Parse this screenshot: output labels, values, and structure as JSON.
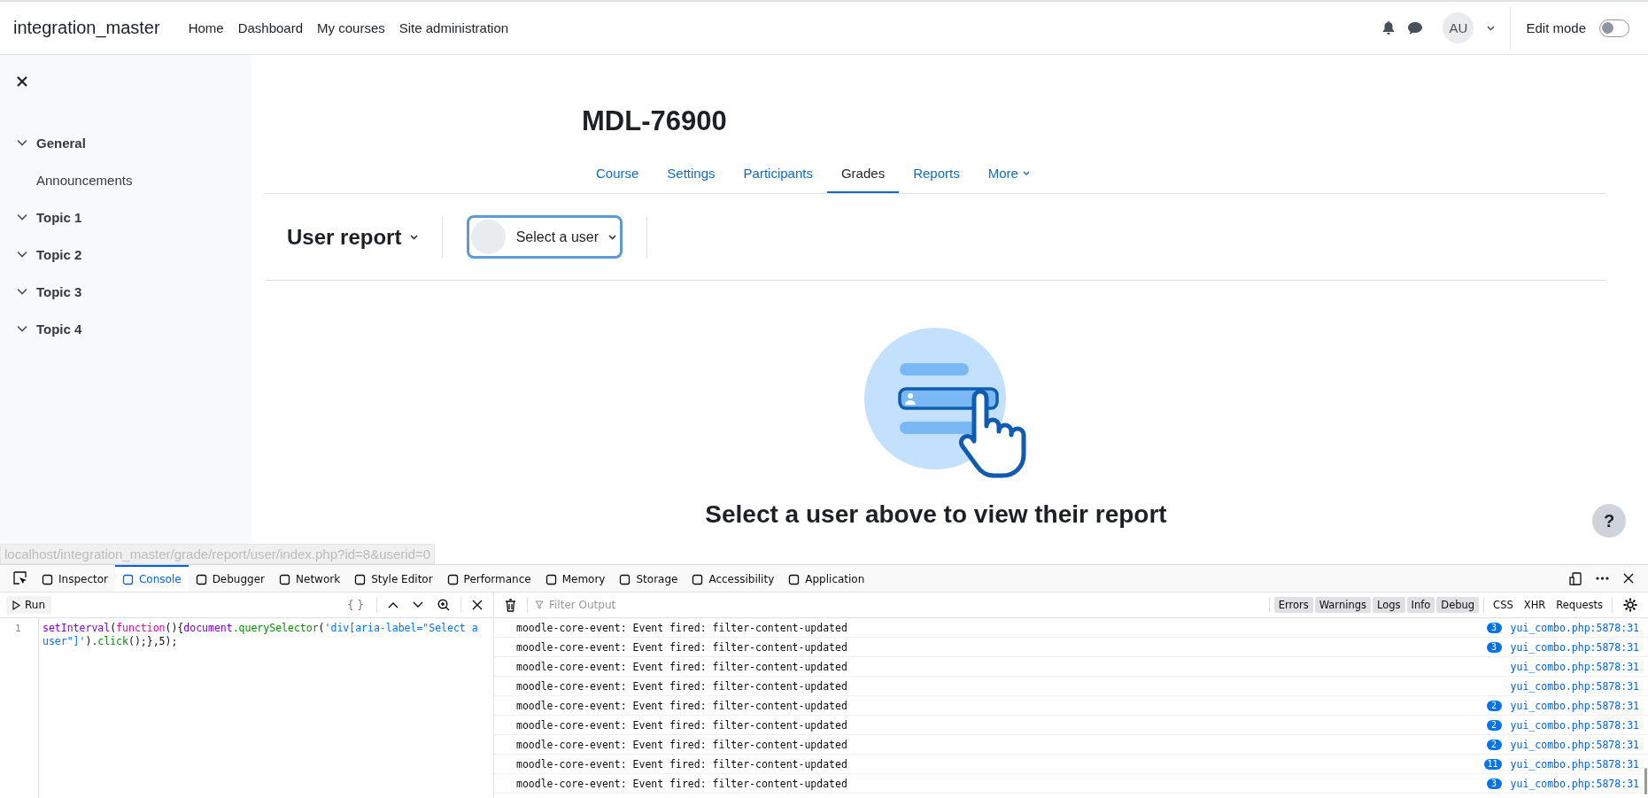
{
  "navbar": {
    "site_name": "integration_master",
    "links": [
      "Home",
      "Dashboard",
      "My courses",
      "Site administration"
    ],
    "avatar": "AU",
    "edit_mode": {
      "label": "Edit mode",
      "on": false
    }
  },
  "sidebar": {
    "items": [
      {
        "label": "General",
        "expanded": true,
        "children": [
          {
            "label": "Announcements"
          }
        ]
      },
      {
        "label": "Topic 1",
        "expanded": true
      },
      {
        "label": "Topic 2",
        "expanded": true
      },
      {
        "label": "Topic 3",
        "expanded": true
      },
      {
        "label": "Topic 4",
        "expanded": true
      }
    ]
  },
  "course": {
    "title": "MDL-76900",
    "tabs": [
      {
        "label": "Course",
        "selected": false
      },
      {
        "label": "Settings",
        "selected": false
      },
      {
        "label": "Participants",
        "selected": false
      },
      {
        "label": "Grades",
        "selected": true
      },
      {
        "label": "Reports",
        "selected": false
      },
      {
        "label": "More",
        "selected": false,
        "dropdown": true
      }
    ],
    "report_selector": "User report",
    "user_selector": "Select a user",
    "empty_message": "Select a user above to view their report",
    "help": "?"
  },
  "status_url": "localhost/integration_master/grade/report/user/index.php?id=8&userid=0",
  "devtools": {
    "tabs": [
      {
        "label": "Inspector",
        "selected": false
      },
      {
        "label": "Console",
        "selected": true
      },
      {
        "label": "Debugger",
        "selected": false
      },
      {
        "label": "Network",
        "selected": false
      },
      {
        "label": "Style Editor",
        "selected": false
      },
      {
        "label": "Performance",
        "selected": false
      },
      {
        "label": "Memory",
        "selected": false
      },
      {
        "label": "Storage",
        "selected": false
      },
      {
        "label": "Accessibility",
        "selected": false
      },
      {
        "label": "Application",
        "selected": false
      }
    ],
    "run": "Run",
    "braces": "{ }",
    "line_number": "1",
    "code": [
      {
        "text": "setInterval",
        "kind": "fn"
      },
      {
        "text": "(",
        "kind": "plain"
      },
      {
        "text": "function",
        "kind": "keyword"
      },
      {
        "text": "(){",
        "kind": "plain"
      },
      {
        "text": "document",
        "kind": "fn"
      },
      {
        "text": ".querySelector",
        "kind": "method"
      },
      {
        "text": "(",
        "kind": "plain"
      },
      {
        "text": "'div[aria-label=\"Select a user\"]'",
        "kind": "string"
      },
      {
        "text": ").",
        "kind": "plain"
      },
      {
        "text": "click",
        "kind": "method"
      },
      {
        "text": "();},5);",
        "kind": "plain"
      }
    ],
    "filter_placeholder": "Filter Output",
    "filters": [
      {
        "label": "Errors",
        "on": true
      },
      {
        "label": "Warnings",
        "on": true
      },
      {
        "label": "Logs",
        "on": true
      },
      {
        "label": "Info",
        "on": true
      },
      {
        "label": "Debug",
        "on": true
      },
      {
        "label": "CSS",
        "on": false
      },
      {
        "label": "XHR",
        "on": false
      },
      {
        "label": "Requests",
        "on": false
      }
    ],
    "messages": [
      {
        "text": "moodle-core-event: Event fired: filter-content-updated",
        "count": "3",
        "source": "yui_combo.php:5878:31"
      },
      {
        "text": "moodle-core-event: Event fired: filter-content-updated",
        "count": "3",
        "source": "yui_combo.php:5878:31"
      },
      {
        "text": "moodle-core-event: Event fired: filter-content-updated",
        "source": "yui_combo.php:5878:31"
      },
      {
        "text": "moodle-core-event: Event fired: filter-content-updated",
        "source": "yui_combo.php:5878:31"
      },
      {
        "text": "moodle-core-event: Event fired: filter-content-updated",
        "count": "2",
        "source": "yui_combo.php:5878:31"
      },
      {
        "text": "moodle-core-event: Event fired: filter-content-updated",
        "count": "2",
        "source": "yui_combo.php:5878:31"
      },
      {
        "text": "moodle-core-event: Event fired: filter-content-updated",
        "count": "2",
        "source": "yui_combo.php:5878:31"
      },
      {
        "text": "moodle-core-event: Event fired: filter-content-updated",
        "count": "11",
        "source": "yui_combo.php:5878:31"
      },
      {
        "text": "moodle-core-event: Event fired: filter-content-updated",
        "count": "3",
        "source": "yui_combo.php:5878:31"
      }
    ]
  }
}
